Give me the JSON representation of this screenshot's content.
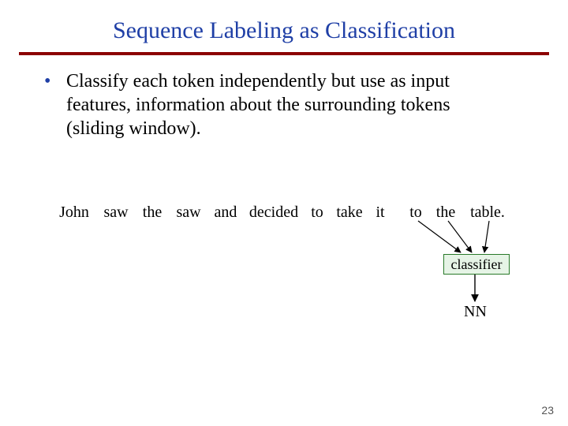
{
  "title": "Sequence Labeling as Classification",
  "bullet": "Classify each token independently but use as input features, information about the surrounding tokens (sliding window).",
  "tokens": {
    "john": "John",
    "saw1": "saw",
    "the1": "the",
    "saw2": "saw",
    "and": "and",
    "decided": "decided",
    "to1": "to",
    "take": "take",
    "it": "it",
    "to2": "to",
    "the2": "the",
    "table": "table."
  },
  "classifier_label": "classifier",
  "output_label": "NN",
  "page_number": "23"
}
